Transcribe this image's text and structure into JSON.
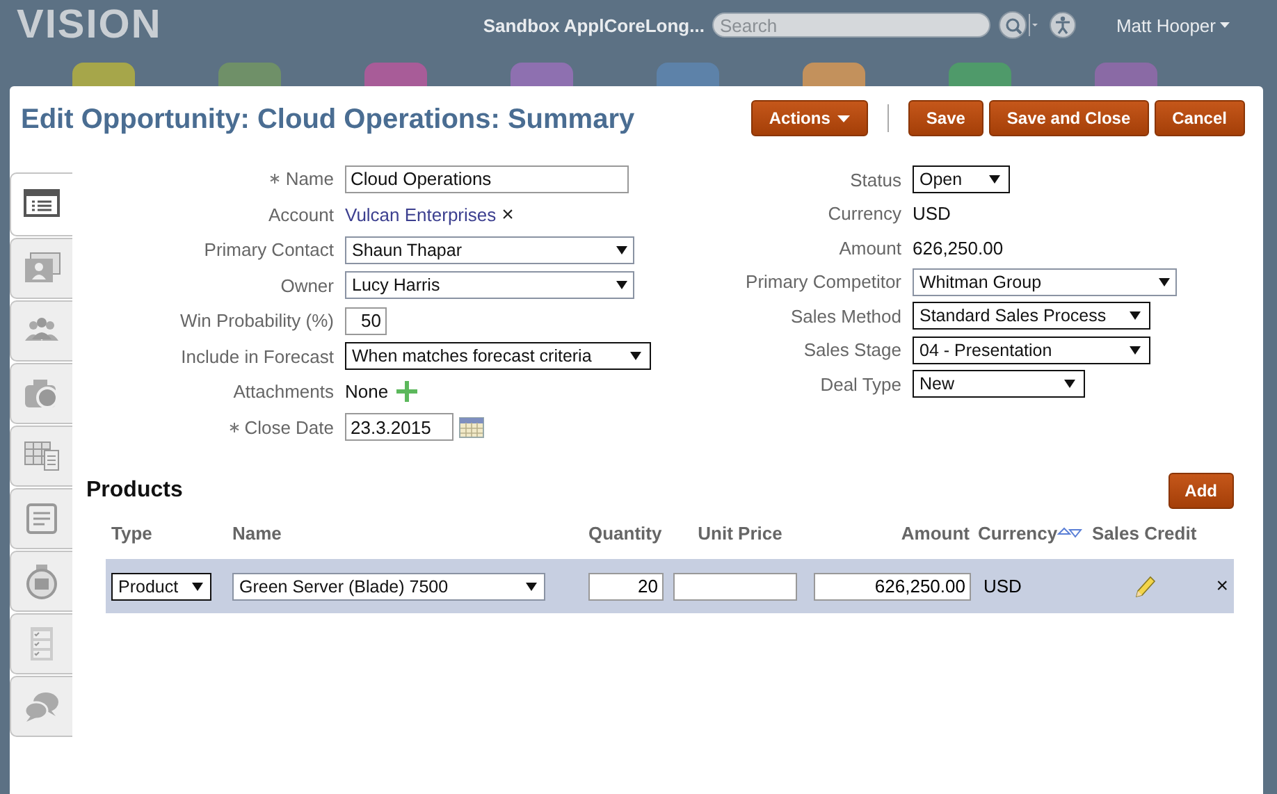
{
  "top_bar": {
    "logo": "VISION",
    "environment": "Sandbox ApplCoreLong...",
    "search": {
      "placeholder": "Search"
    },
    "user": "Matt Hooper",
    "launcher": [
      {
        "color": "#a6a64a"
      },
      {
        "color": "#6f9068"
      },
      {
        "color": "#a85c98"
      },
      {
        "color": "#8e70b0"
      },
      {
        "color": "#5d82a9"
      },
      {
        "color": "#c3915c"
      },
      {
        "color": "#4f9a6a"
      },
      {
        "color": "#8a6aa5"
      }
    ]
  },
  "dialog": {
    "title": "Edit Opportunity: Cloud Operations: Summary",
    "buttons": [
      {
        "label": "Actions",
        "kind": "menu"
      },
      {
        "label": "Save",
        "kind": "plain"
      },
      {
        "label": "Save and Close",
        "kind": "mnemonic"
      },
      {
        "label": "Cancel",
        "kind": "mnemonic"
      }
    ]
  },
  "side_tabs": [
    {
      "kind": "list",
      "selected": true
    },
    {
      "kind": "card",
      "selected": false
    },
    {
      "kind": "people",
      "selected": false
    },
    {
      "kind": "camera",
      "selected": false
    },
    {
      "kind": "grid",
      "selected": false
    },
    {
      "kind": "note",
      "selected": false
    },
    {
      "kind": "timer",
      "selected": false
    },
    {
      "kind": "checklist",
      "selected": false
    },
    {
      "kind": "chat",
      "selected": false
    }
  ],
  "form_left": [
    {
      "label": "Name",
      "required": true,
      "kind": "text",
      "value": "Cloud Operations"
    },
    {
      "label": "Account",
      "required": false,
      "kind": "link",
      "value": "Vulcan Enterprises",
      "remove": "×"
    },
    {
      "label": "Primary Contact",
      "required": false,
      "kind": "combobox",
      "value": "Shaun Thapar"
    },
    {
      "label": "Owner",
      "required": false,
      "kind": "combobox",
      "value": "Lucy Harris"
    },
    {
      "label": "Win Probability (%)",
      "required": false,
      "kind": "number",
      "value": "50"
    },
    {
      "label": "Include in Forecast",
      "required": false,
      "kind": "select",
      "value": "When matches forecast criteria"
    },
    {
      "label": "Attachments",
      "required": false,
      "kind": "attachments",
      "value": "None"
    },
    {
      "label": "Close Date",
      "required": true,
      "kind": "date",
      "value": "23.3.2015"
    }
  ],
  "form_right": [
    {
      "label": "Status",
      "required": false,
      "kind": "select",
      "value": "Open"
    },
    {
      "label": "Currency",
      "required": false,
      "kind": "plain",
      "value": "USD"
    },
    {
      "label": "Amount",
      "required": false,
      "kind": "plain",
      "value": "626,250.00"
    },
    {
      "label": "Primary Competitor",
      "required": false,
      "kind": "combobox",
      "value": "Whitman Group"
    },
    {
      "label": "Sales Method",
      "required": false,
      "kind": "select",
      "value": "Standard Sales Process"
    },
    {
      "label": "Sales Stage",
      "required": false,
      "kind": "select",
      "value": "04 - Presentation"
    },
    {
      "label": "Deal Type",
      "required": false,
      "kind": "select",
      "value": "New"
    }
  ],
  "products": {
    "title": "Products",
    "add_button": "Add",
    "columns": [
      "Type",
      "Name",
      "Quantity",
      "Unit Price",
      "Amount",
      "Currency",
      "Sales Credit"
    ],
    "rows": [
      {
        "selected": true,
        "type": "Product",
        "name": "Green Server (Blade) 7500",
        "quantity": "20",
        "amount": "626,250.00",
        "currency": "USD",
        "delete": "×"
      }
    ]
  }
}
